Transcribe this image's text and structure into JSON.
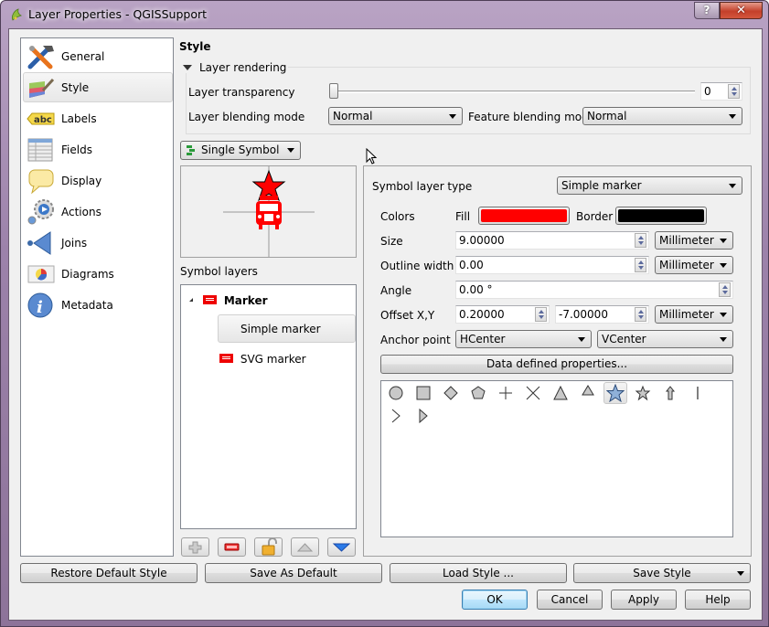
{
  "window": {
    "title": "Layer Properties - QGISSupport",
    "help_label": "?",
    "close_label": "✕"
  },
  "sidebar": {
    "items": [
      {
        "label": "General",
        "icon": "hammer-wrench-icon"
      },
      {
        "label": "Style",
        "icon": "paintbrush-icon",
        "active": true
      },
      {
        "label": "Labels",
        "icon": "abc-label-icon"
      },
      {
        "label": "Fields",
        "icon": "table-icon"
      },
      {
        "label": "Display",
        "icon": "speech-bubble-icon"
      },
      {
        "label": "Actions",
        "icon": "gears-play-icon"
      },
      {
        "label": "Joins",
        "icon": "join-arrow-icon"
      },
      {
        "label": "Diagrams",
        "icon": "pie-map-icon"
      },
      {
        "label": "Metadata",
        "icon": "info-icon"
      }
    ]
  },
  "style": {
    "section_title": "Style",
    "layer_rendering": {
      "header": "Layer rendering",
      "transparency_label": "Layer transparency",
      "transparency_value": "0",
      "transparency_percent": 0,
      "layer_blending_label": "Layer blending mode",
      "layer_blending_value": "Normal",
      "feature_blending_label": "Feature blending mode",
      "feature_blending_value": "Normal"
    },
    "renderer_value": "Single Symbol",
    "symbol_layers_label": "Symbol layers",
    "tree": {
      "root": "Marker",
      "children": [
        "Simple marker",
        "SVG marker"
      ],
      "selected": "Simple marker"
    },
    "toolbar": [
      "add-layer",
      "remove-layer",
      "lock",
      "move-up",
      "move-down"
    ]
  },
  "symbol_layer": {
    "type_label": "Symbol layer type",
    "type_value": "Simple marker",
    "colors_label": "Colors",
    "fill_label": "Fill",
    "fill_color": "#ff0000",
    "border_label": "Border",
    "border_color": "#000000",
    "size_label": "Size",
    "size_value": "9.00000",
    "size_unit": "Millimeter",
    "outline_label": "Outline width",
    "outline_value": "0.00",
    "outline_unit": "Millimeter",
    "angle_label": "Angle",
    "angle_value": "0.00 °",
    "offset_label": "Offset X,Y",
    "offset_x": "0.20000",
    "offset_y": "-7.00000",
    "offset_unit": "Millimeter",
    "anchor_label": "Anchor point",
    "anchor_h": "HCenter",
    "anchor_v": "VCenter",
    "data_defined_label": "Data defined properties...",
    "shapes": [
      "circle",
      "square",
      "diamond",
      "pentagon",
      "cross",
      "x",
      "triangle",
      "equilateral-triangle",
      "star",
      "regular-star",
      "arrow",
      "line",
      "arrowhead",
      "filled-arrowhead"
    ],
    "selected_shape": "star"
  },
  "footer": {
    "restore_label": "Restore Default Style",
    "save_default_label": "Save As Default",
    "load_label": "Load Style ...",
    "save_style_label": "Save Style",
    "ok_label": "OK",
    "cancel_label": "Cancel",
    "apply_label": "Apply",
    "help_label": "Help"
  }
}
